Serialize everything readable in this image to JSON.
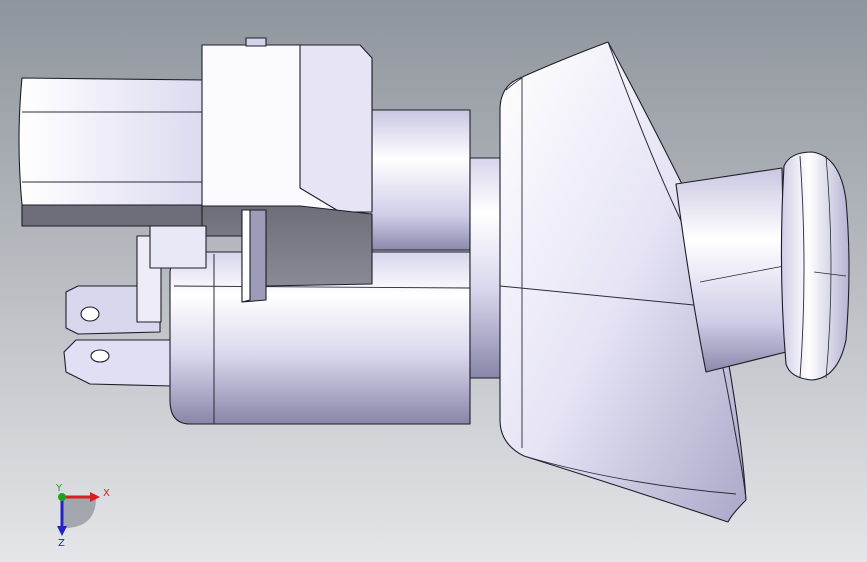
{
  "viewport": {
    "background_top": "#8f959c",
    "background_bottom": "#e4e6e9"
  },
  "triad": {
    "x_label": "X",
    "y_label": "Y",
    "z_label": "Z",
    "x_color": "#d42020",
    "y_color": "#21a321",
    "z_color": "#2323c8"
  }
}
